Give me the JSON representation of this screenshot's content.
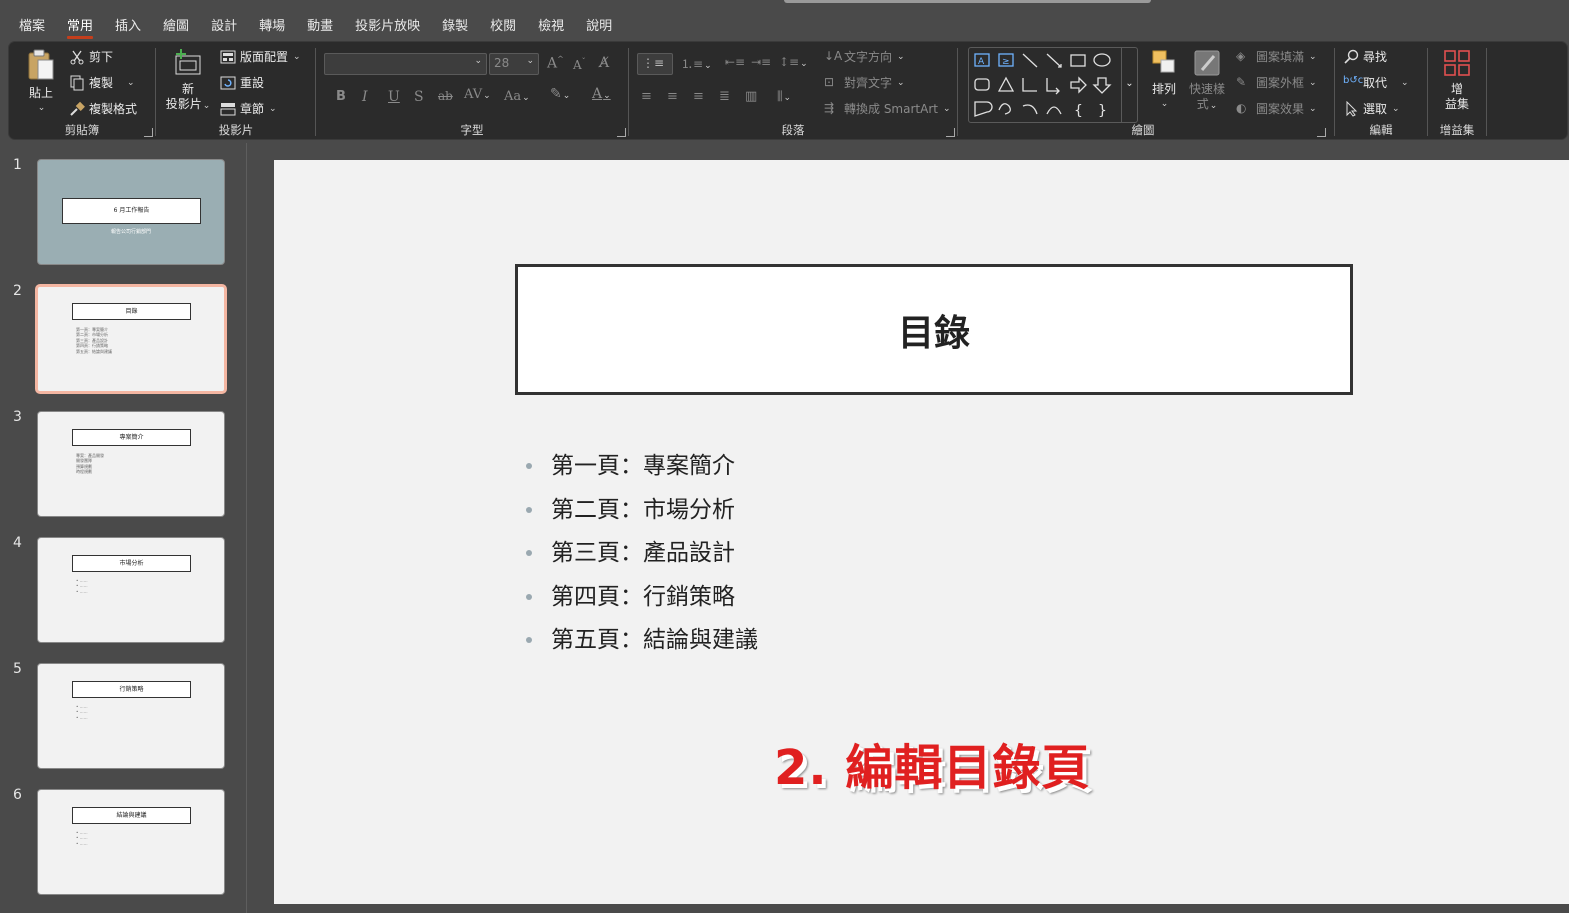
{
  "menu": {
    "tabs": [
      "檔案",
      "常用",
      "插入",
      "繪圖",
      "設計",
      "轉場",
      "動畫",
      "投影片放映",
      "錄製",
      "校閱",
      "檢視",
      "說明"
    ],
    "active_tab": "常用"
  },
  "ribbon": {
    "clipboard": {
      "label": "剪貼簿",
      "paste": "貼上",
      "cut": "剪下",
      "copy": "複製",
      "format_painter": "複製格式"
    },
    "slides": {
      "label": "投影片",
      "new_slide_line1": "新",
      "new_slide_line2": "投影片",
      "layout": "版面配置",
      "reset": "重設",
      "section": "章節"
    },
    "font": {
      "label": "字型",
      "font_name": "",
      "font_size": "28"
    },
    "paragraph": {
      "label": "段落",
      "text_direction": "文字方向",
      "align_text": "對齊文字",
      "convert_smartart": "轉換成 SmartArt"
    },
    "drawing": {
      "label": "繪圖",
      "arrange": "排列",
      "quick_styles_line1": "快速樣",
      "quick_styles_line2": "式",
      "shape_fill": "圖案填滿",
      "shape_outline": "圖案外框",
      "shape_effects": "圖案效果"
    },
    "editing": {
      "label": "編輯",
      "find": "尋找",
      "replace": "取代",
      "select": "選取"
    },
    "addins": {
      "label": "增益集",
      "button_line1": "增",
      "button_line2": "益集"
    }
  },
  "thumbnails": [
    {
      "number": "1",
      "title": "6 月工作報告",
      "subtitle": "報告公司行銷部門",
      "lines": []
    },
    {
      "number": "2",
      "title": "目錄",
      "subtitle": "",
      "lines": [
        "第一頁：專案簡介",
        "第二頁：市場分析",
        "第三頁：產品設計",
        "第四頁：行銷策略",
        "第五頁：結論與建議"
      ]
    },
    {
      "number": "3",
      "title": "專案簡介",
      "subtitle": "",
      "lines": [
        "專案：產品開發",
        "開發團隊",
        "預算規劃",
        "時程規劃"
      ]
    },
    {
      "number": "4",
      "title": "市場分析",
      "subtitle": "",
      "lines": [
        "• ……",
        "• ……",
        "• ……"
      ]
    },
    {
      "number": "5",
      "title": "行銷策略",
      "subtitle": "",
      "lines": [
        "• ……",
        "• ……",
        "• ……"
      ]
    },
    {
      "number": "6",
      "title": "結論與建議",
      "subtitle": "",
      "lines": [
        "• ……",
        "• ……",
        "• ……"
      ]
    }
  ],
  "slide": {
    "title": "目錄",
    "bullets": [
      "第一頁：專案簡介",
      "第二頁：市場分析",
      "第三頁：產品設計",
      "第四頁：行銷策略",
      "第五頁：結論與建議"
    ],
    "caption": "2. 編輯目錄頁"
  }
}
